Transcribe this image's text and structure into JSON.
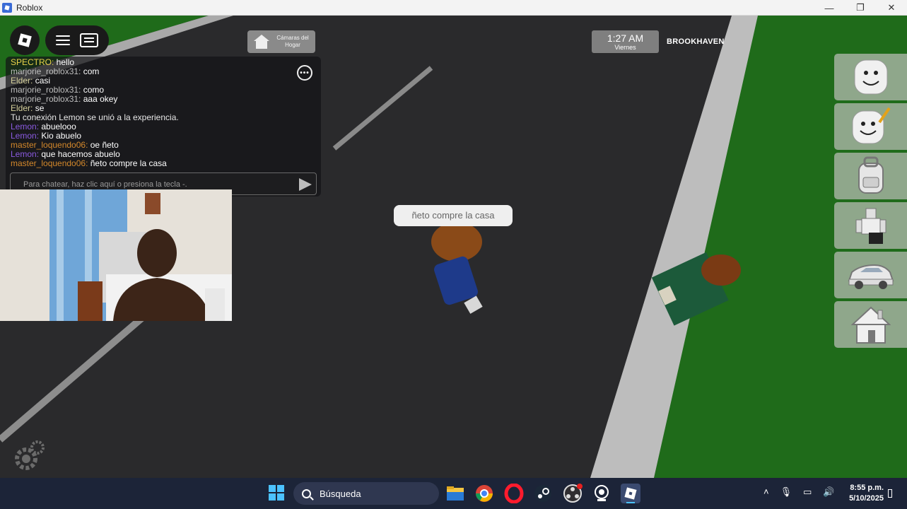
{
  "window": {
    "title": "Roblox",
    "minimize_glyph": "—",
    "maximize_glyph": "❐",
    "close_glyph": "✕"
  },
  "hud": {
    "cameras_label": "Cámaras del Hogar",
    "clock_time": "1:27 AM",
    "clock_day": "Viernes",
    "location": "BROOKHAVEN"
  },
  "chat": {
    "more_glyph": "•••",
    "input_placeholder": "Para chatear, haz clic aquí o presiona la tecla -.",
    "messages": [
      {
        "name": "SPECTRO:",
        "text": " hello",
        "color": "y"
      },
      {
        "name": "marjorie_roblox31:",
        "text": " com",
        "color": "gr"
      },
      {
        "name": "Elder:",
        "text": " casi",
        "color": "g"
      },
      {
        "name": "marjorie_roblox31:",
        "text": " como",
        "color": "gr"
      },
      {
        "name": "marjorie_roblox31:",
        "text": " aaa okey",
        "color": "gr"
      },
      {
        "name": "Elder:",
        "text": " se",
        "color": "g"
      },
      {
        "name": "",
        "text": "Tu conexión Lemon se unió a la experiencia.",
        "color": "sys"
      },
      {
        "name": "Lemon:",
        "text": " abuelooo",
        "color": "p"
      },
      {
        "name": "Lemon:",
        "text": " Kio abuelo",
        "color": "p"
      },
      {
        "name": "master_loquendo06:",
        "text": " oe ñeto",
        "color": "o"
      },
      {
        "name": "Lemon:",
        "text": " que hacemos abuelo",
        "color": "p"
      },
      {
        "name": "master_loquendo06:",
        "text": " ñeto compre la casa",
        "color": "o"
      }
    ]
  },
  "speech_bubble": "ñeto compre la casa",
  "side_buttons": [
    {
      "icon": "face-icon"
    },
    {
      "icon": "face-edit-icon"
    },
    {
      "icon": "backpack-icon"
    },
    {
      "icon": "avatar-clothing-icon"
    },
    {
      "icon": "car-icon"
    },
    {
      "icon": "house-icon"
    }
  ],
  "taskbar": {
    "search_label": "Búsqueda",
    "time": "8:55 p.m.",
    "date": "5/10/2025",
    "apps": [
      "file-explorer-icon",
      "chrome-icon",
      "opera-icon",
      "steam-icon",
      "obs-icon",
      "webcam-app-icon",
      "roblox-icon"
    ]
  },
  "colors": {
    "grass": "#1f6b1a",
    "road": "#2a2a2c",
    "sidewalk": "#bcbcbc",
    "taskbar": "#1c2438"
  }
}
